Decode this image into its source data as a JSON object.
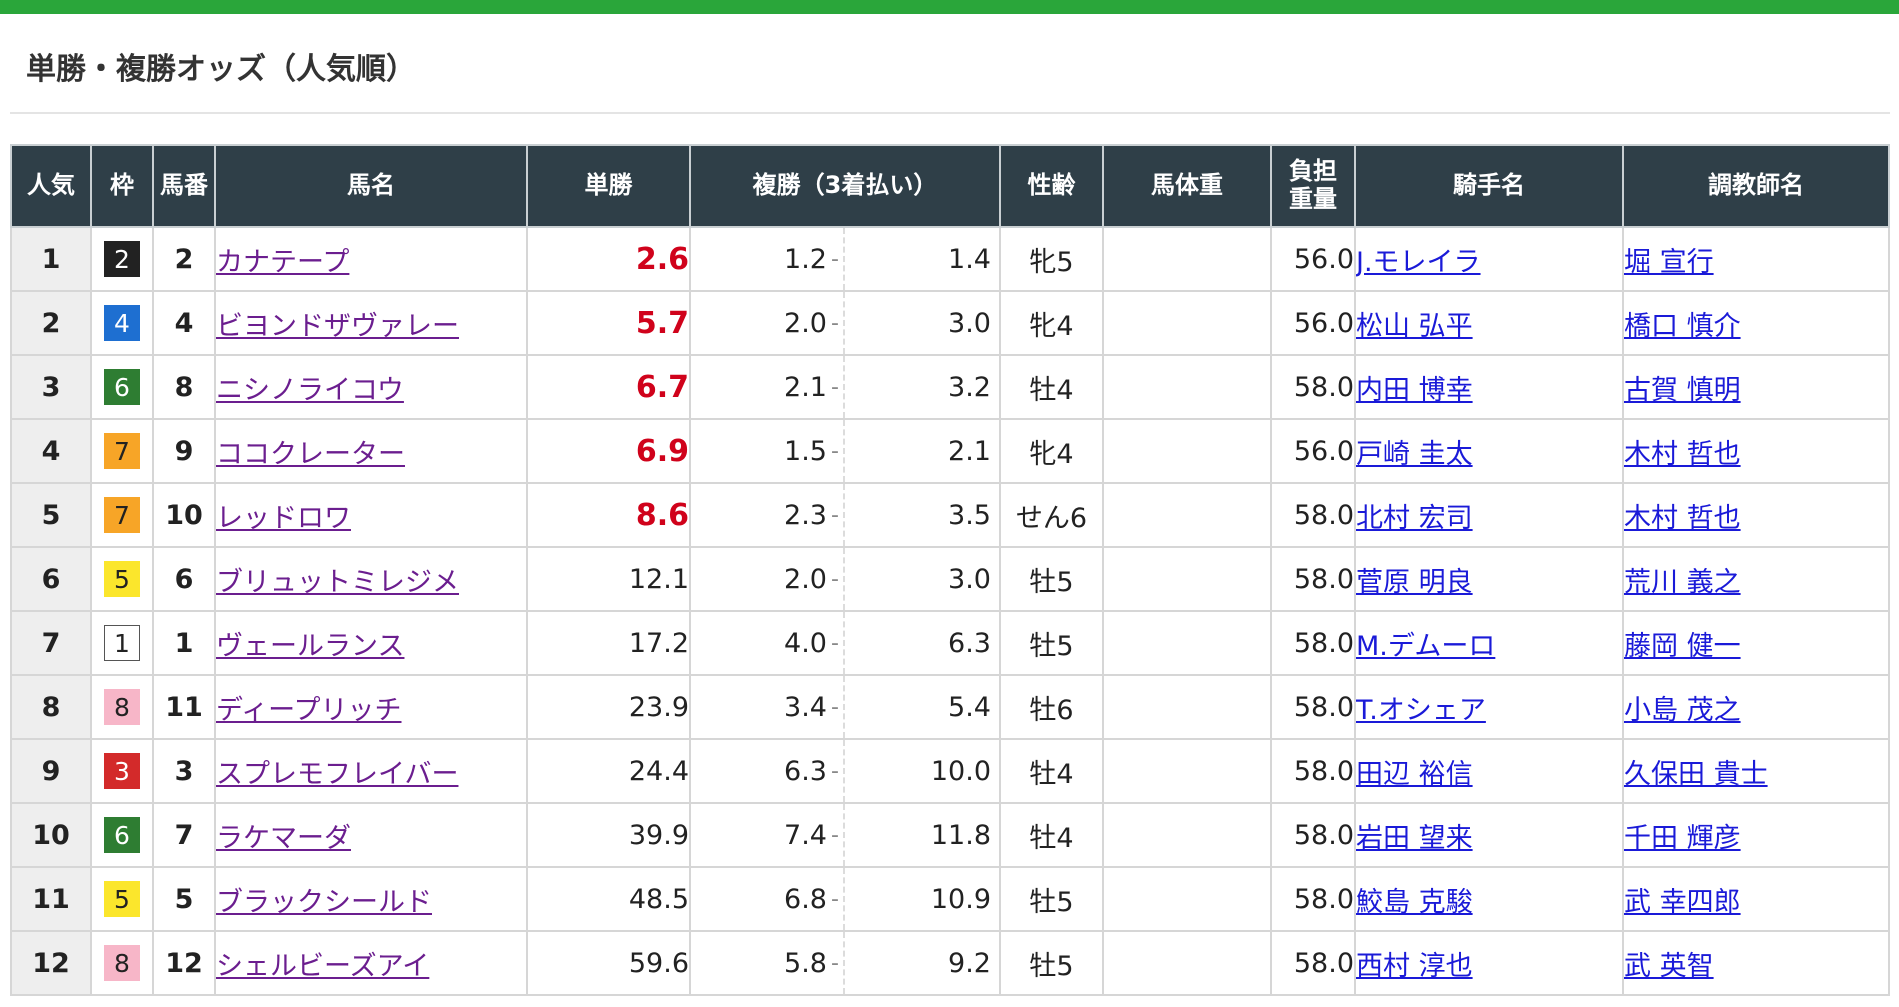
{
  "heading": "単勝・複勝オッズ（人気順）",
  "colors": {
    "header_bg": "#2f3f48",
    "top_bar": "#2aa63a",
    "hot_odds": "#d0021b",
    "horse_link": "#6b1e8f",
    "person_link": "#1a1ad8"
  },
  "columns": {
    "popularity": "人気",
    "waku": "枠",
    "umaban": "馬番",
    "horse": "馬名",
    "win": "単勝",
    "place": "複勝（3着払い）",
    "sex_age": "性齢",
    "body_weight": "馬体重",
    "burden_weight_line1": "負担",
    "burden_weight_line2": "重量",
    "jockey": "騎手名",
    "trainer": "調教師名"
  },
  "place_separator": "-",
  "waku_styles": {
    "1": {
      "bg": "#ffffff",
      "fg": "#222222",
      "border": "#555555"
    },
    "2": {
      "bg": "#222222",
      "fg": "#ffffff",
      "border": "#222222"
    },
    "3": {
      "bg": "#d32a2a",
      "fg": "#ffffff",
      "border": "#d32a2a"
    },
    "4": {
      "bg": "#1e6fd1",
      "fg": "#ffffff",
      "border": "#1e6fd1"
    },
    "5": {
      "bg": "#fbe62c",
      "fg": "#222222",
      "border": "#fbe62c"
    },
    "6": {
      "bg": "#2e7d32",
      "fg": "#ffffff",
      "border": "#2e7d32"
    },
    "7": {
      "bg": "#f7a527",
      "fg": "#222222",
      "border": "#f7a527"
    },
    "8": {
      "bg": "#f7b6c8",
      "fg": "#222222",
      "border": "#f7b6c8"
    }
  },
  "rows": [
    {
      "pop": "1",
      "waku": "2",
      "num": "2",
      "horse": "カナテープ",
      "win": "2.6",
      "hot": true,
      "place_lo": "1.2",
      "place_hi": "1.4",
      "sex_age": "牝5",
      "body_weight": "",
      "burden": "56.0",
      "jockey": "J.モレイラ",
      "trainer": "堀 宣行"
    },
    {
      "pop": "2",
      "waku": "4",
      "num": "4",
      "horse": "ビヨンドザヴァレー",
      "win": "5.7",
      "hot": true,
      "place_lo": "2.0",
      "place_hi": "3.0",
      "sex_age": "牝4",
      "body_weight": "",
      "burden": "56.0",
      "jockey": "松山 弘平",
      "trainer": "橋口 慎介"
    },
    {
      "pop": "3",
      "waku": "6",
      "num": "8",
      "horse": "ニシノライコウ",
      "win": "6.7",
      "hot": true,
      "place_lo": "2.1",
      "place_hi": "3.2",
      "sex_age": "牡4",
      "body_weight": "",
      "burden": "58.0",
      "jockey": "内田 博幸",
      "trainer": "古賀 慎明"
    },
    {
      "pop": "4",
      "waku": "7",
      "num": "9",
      "horse": "ココクレーター",
      "win": "6.9",
      "hot": true,
      "place_lo": "1.5",
      "place_hi": "2.1",
      "sex_age": "牝4",
      "body_weight": "",
      "burden": "56.0",
      "jockey": "戸崎 圭太",
      "trainer": "木村 哲也"
    },
    {
      "pop": "5",
      "waku": "7",
      "num": "10",
      "horse": "レッドロワ",
      "win": "8.6",
      "hot": true,
      "place_lo": "2.3",
      "place_hi": "3.5",
      "sex_age": "せん6",
      "body_weight": "",
      "burden": "58.0",
      "jockey": "北村 宏司",
      "trainer": "木村 哲也"
    },
    {
      "pop": "6",
      "waku": "5",
      "num": "6",
      "horse": "ブリュットミレジメ",
      "win": "12.1",
      "hot": false,
      "place_lo": "2.0",
      "place_hi": "3.0",
      "sex_age": "牡5",
      "body_weight": "",
      "burden": "58.0",
      "jockey": "菅原 明良",
      "trainer": "荒川 義之"
    },
    {
      "pop": "7",
      "waku": "1",
      "num": "1",
      "horse": "ヴェールランス",
      "win": "17.2",
      "hot": false,
      "place_lo": "4.0",
      "place_hi": "6.3",
      "sex_age": "牡5",
      "body_weight": "",
      "burden": "58.0",
      "jockey": "M.デムーロ",
      "trainer": "藤岡 健一"
    },
    {
      "pop": "8",
      "waku": "8",
      "num": "11",
      "horse": "ディープリッチ",
      "win": "23.9",
      "hot": false,
      "place_lo": "3.4",
      "place_hi": "5.4",
      "sex_age": "牡6",
      "body_weight": "",
      "burden": "58.0",
      "jockey": "T.オシェア",
      "trainer": "小島 茂之"
    },
    {
      "pop": "9",
      "waku": "3",
      "num": "3",
      "horse": "スプレモフレイバー",
      "win": "24.4",
      "hot": false,
      "place_lo": "6.3",
      "place_hi": "10.0",
      "sex_age": "牡4",
      "body_weight": "",
      "burden": "58.0",
      "jockey": "田辺 裕信",
      "trainer": "久保田 貴士"
    },
    {
      "pop": "10",
      "waku": "6",
      "num": "7",
      "horse": "ラケマーダ",
      "win": "39.9",
      "hot": false,
      "place_lo": "7.4",
      "place_hi": "11.8",
      "sex_age": "牡4",
      "body_weight": "",
      "burden": "58.0",
      "jockey": "岩田 望来",
      "trainer": "千田 輝彦"
    },
    {
      "pop": "11",
      "waku": "5",
      "num": "5",
      "horse": "ブラックシールド",
      "win": "48.5",
      "hot": false,
      "place_lo": "6.8",
      "place_hi": "10.9",
      "sex_age": "牡5",
      "body_weight": "",
      "burden": "58.0",
      "jockey": "鮫島 克駿",
      "trainer": "武 幸四郎"
    },
    {
      "pop": "12",
      "waku": "8",
      "num": "12",
      "horse": "シェルビーズアイ",
      "win": "59.6",
      "hot": false,
      "place_lo": "5.8",
      "place_hi": "9.2",
      "sex_age": "牡5",
      "body_weight": "",
      "burden": "58.0",
      "jockey": "西村 淳也",
      "trainer": "武 英智"
    }
  ]
}
